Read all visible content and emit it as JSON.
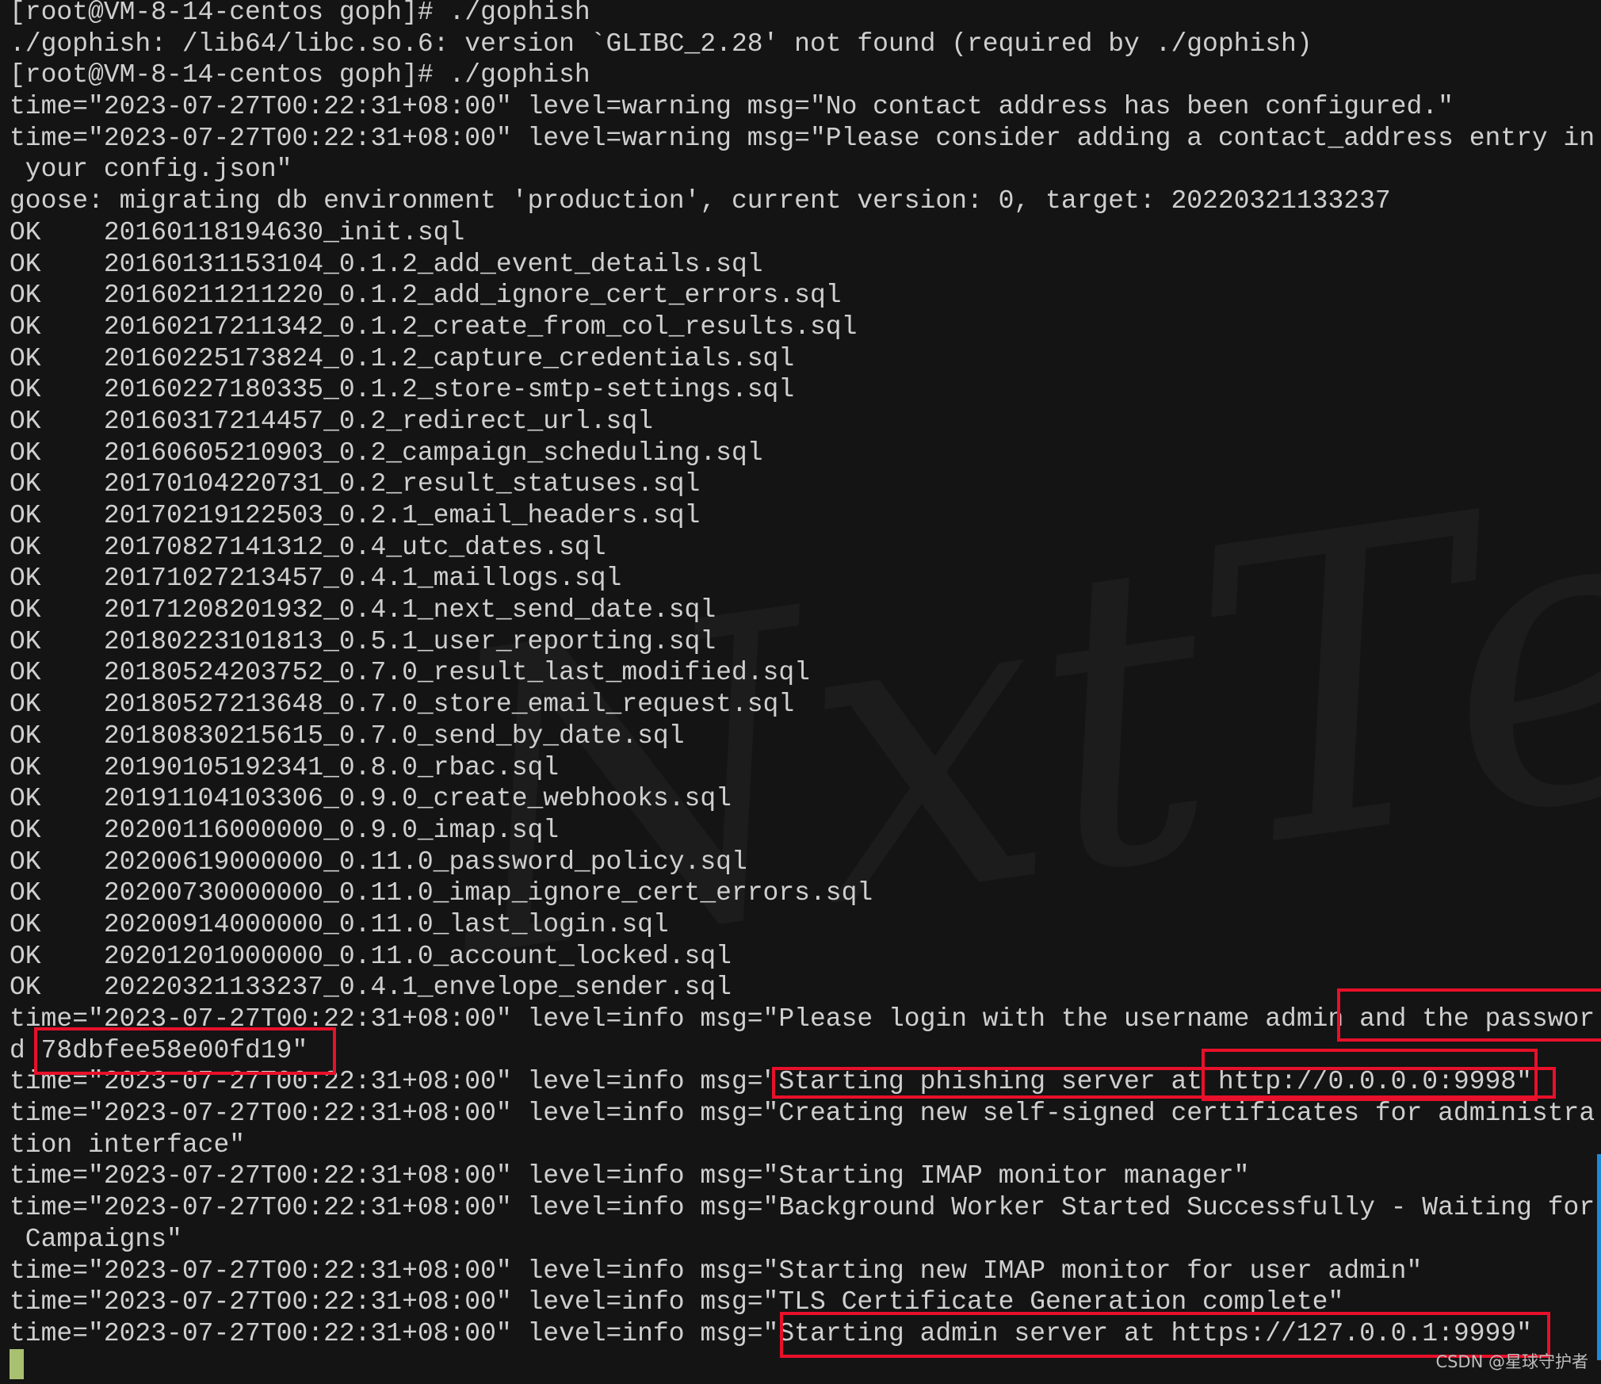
{
  "watermark": "NxtTerm",
  "colors": {
    "background": "#141414",
    "text": "#cfcfcf",
    "highlight": "#e8102a",
    "cursor": "#a8c070",
    "scrollbar": "#1e88d8"
  },
  "lines": [
    "[root@VM-8-14-centos goph]# ./gophish",
    "./gophish: /lib64/libc.so.6: version `GLIBC_2.28' not found (required by ./gophish)",
    "[root@VM-8-14-centos goph]# ./gophish",
    "time=\"2023-07-27T00:22:31+08:00\" level=warning msg=\"No contact address has been configured.\"",
    "time=\"2023-07-27T00:22:31+08:00\" level=warning msg=\"Please consider adding a contact_address entry in",
    " your config.json\"",
    "goose: migrating db environment 'production', current version: 0, target: 20220321133237",
    "OK    20160118194630_init.sql",
    "OK    20160131153104_0.1.2_add_event_details.sql",
    "OK    20160211211220_0.1.2_add_ignore_cert_errors.sql",
    "OK    20160217211342_0.1.2_create_from_col_results.sql",
    "OK    20160225173824_0.1.2_capture_credentials.sql",
    "OK    20160227180335_0.1.2_store-smtp-settings.sql",
    "OK    20160317214457_0.2_redirect_url.sql",
    "OK    20160605210903_0.2_campaign_scheduling.sql",
    "OK    20170104220731_0.2_result_statuses.sql",
    "OK    20170219122503_0.2.1_email_headers.sql",
    "OK    20170827141312_0.4_utc_dates.sql",
    "OK    20171027213457_0.4.1_maillogs.sql",
    "OK    20171208201932_0.4.1_next_send_date.sql",
    "OK    20180223101813_0.5.1_user_reporting.sql",
    "OK    20180524203752_0.7.0_result_last_modified.sql",
    "OK    20180527213648_0.7.0_store_email_request.sql",
    "OK    20180830215615_0.7.0_send_by_date.sql",
    "OK    20190105192341_0.8.0_rbac.sql",
    "OK    20191104103306_0.9.0_create_webhooks.sql",
    "OK    20200116000000_0.9.0_imap.sql",
    "OK    20200619000000_0.11.0_password_policy.sql",
    "OK    20200730000000_0.11.0_imap_ignore_cert_errors.sql",
    "OK    20200914000000_0.11.0_last_login.sql",
    "OK    20201201000000_0.11.0_account_locked.sql",
    "OK    20220321133237_0.4.1_envelope_sender.sql",
    "time=\"2023-07-27T00:22:31+08:00\" level=info msg=\"Please login with the username admin and the passwor",
    "d 78dbfee58e00fd19\"",
    "time=\"2023-07-27T00:22:31+08:00\" level=info msg=\"Starting phishing server at http://0.0.0.0:9998\"",
    "time=\"2023-07-27T00:22:31+08:00\" level=info msg=\"Creating new self-signed certificates for administra",
    "tion interface\"",
    "time=\"2023-07-27T00:22:31+08:00\" level=info msg=\"Starting IMAP monitor manager\"",
    "time=\"2023-07-27T00:22:31+08:00\" level=info msg=\"Background Worker Started Successfully - Waiting for",
    " Campaigns\"",
    "time=\"2023-07-27T00:22:31+08:00\" level=info msg=\"Starting new IMAP monitor for user admin\"",
    "time=\"2023-07-27T00:22:31+08:00\" level=info msg=\"TLS Certificate Generation complete\"",
    "time=\"2023-07-27T00:22:31+08:00\" level=info msg=\"Starting admin server at https://127.0.0.1:9999\""
  ],
  "credit": "CSDN @星球守护者"
}
